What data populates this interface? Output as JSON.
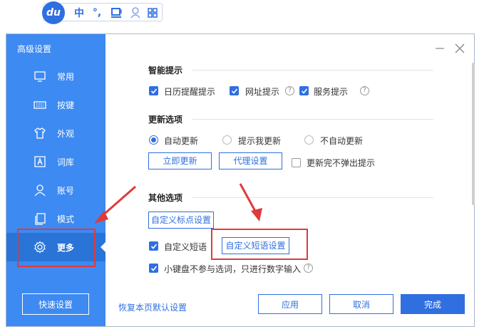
{
  "ime": {
    "logo": "du",
    "mode_label": "中",
    "punct_label": "°,"
  },
  "window": {
    "sidebar_title": "高级设置",
    "nav": [
      {
        "label": "常用",
        "icon": "monitor-icon"
      },
      {
        "label": "按键",
        "icon": "keyboard-icon"
      },
      {
        "label": "外观",
        "icon": "shirt-icon"
      },
      {
        "label": "词库",
        "icon": "letter-a-icon"
      },
      {
        "label": "账号",
        "icon": "user-icon"
      },
      {
        "label": "模式",
        "icon": "copy-icon"
      },
      {
        "label": "更多",
        "icon": "gear-icon",
        "active": true
      }
    ],
    "quick_settings_label": "快速设置"
  },
  "smart": {
    "title": "智能提示",
    "options": [
      {
        "label": "日历提醒提示",
        "checked": true
      },
      {
        "label": "网址提示",
        "checked": true,
        "help": true
      },
      {
        "label": "服务提示",
        "checked": true,
        "help": true
      }
    ]
  },
  "update": {
    "title": "更新选项",
    "radios": [
      {
        "label": "自动更新",
        "selected": true
      },
      {
        "label": "提示我更新",
        "selected": false
      },
      {
        "label": "不自动更新",
        "selected": false
      }
    ],
    "update_now_label": "立即更新",
    "proxy_label": "代理设置",
    "no_popup_label": "更新完不弹出提示",
    "no_popup_checked": false
  },
  "other": {
    "title": "其他选项",
    "custom_punct_label": "自定义标点设置",
    "custom_phrase_label": "自定义短语",
    "custom_phrase_checked": true,
    "custom_phrase_settings_label": "自定义短语设置",
    "keypad_label": "小键盘不参与选词，只进行数字输入",
    "keypad_checked": true
  },
  "footer": {
    "restore_label": "恢复本页默认设置",
    "apply_label": "应用",
    "cancel_label": "取消",
    "done_label": "完成"
  },
  "colors": {
    "sidebar": "#3d8af2",
    "accent": "#2f6fe0",
    "annotation": "#e03a3a"
  }
}
